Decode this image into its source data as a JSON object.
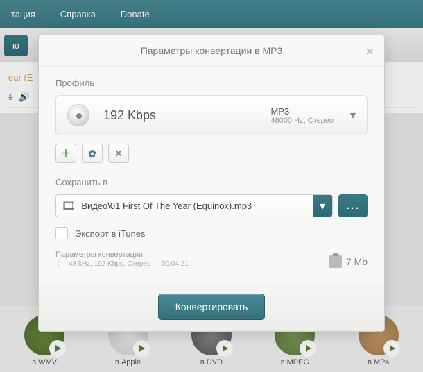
{
  "menubar": {
    "items": [
      "тация",
      "Справка",
      "Donate"
    ]
  },
  "bg": {
    "toolbarButton": "ю",
    "fileRow": {
      "name": "ear (E",
      "flag": "1"
    }
  },
  "dialog": {
    "title": "Параметры конвертации в MP3",
    "profile": {
      "label": "Профиль",
      "bitrate": "192 Kbps",
      "format": "MP3",
      "detail": "48000 Hz,  Стерео"
    },
    "save": {
      "label": "Сохранить в",
      "path": "Видео\\01 First Of The Year (Equinox).mp3"
    },
    "export": {
      "label": "Экспорт в iTunes",
      "checked": false
    },
    "params": {
      "title": "Параметры конвертации",
      "details": "48 kHz, 192 Kbps, Стерео — 00:04:21"
    },
    "size": "7 Mb",
    "convertLabel": "Конвертировать"
  },
  "formats": [
    "в WMV",
    "в Apple",
    "в DVD",
    "в MPEG",
    "в MP4"
  ]
}
